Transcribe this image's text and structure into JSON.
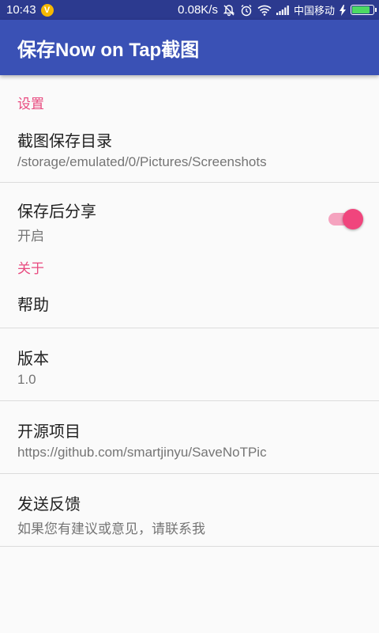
{
  "status_bar": {
    "time": "10:43",
    "badge": "V",
    "net_speed": "0.08K/s",
    "carrier": "中国移动",
    "icons": [
      "mute-bell-icon",
      "alarm-icon",
      "wifi-icon",
      "signal-icon",
      "charging-icon",
      "battery-icon"
    ],
    "battery_level": 0.85
  },
  "app_bar": {
    "title": "保存Now on Tap截图"
  },
  "colors": {
    "status_bar": "#2c3a8f",
    "app_bar": "#3a51b5",
    "accent": "#e84a7f",
    "background": "#fafafa"
  },
  "sections": [
    {
      "category": "设置",
      "items": [
        {
          "title": "截图保存目录",
          "summary": "/storage/emulated/0/Pictures/Screenshots"
        },
        {
          "title": "保存后分享",
          "summary": "开启",
          "switch_on": true
        }
      ]
    },
    {
      "category": "关于",
      "items": [
        {
          "title": "帮助",
          "summary": ""
        },
        {
          "title": "版本",
          "summary": "1.0"
        },
        {
          "title": "开源项目",
          "summary": "https://github.com/smartjinyu/SaveNoTPic"
        },
        {
          "title": "发送反馈",
          "summary": "如果您有建议或意见，请联系我"
        }
      ]
    }
  ]
}
